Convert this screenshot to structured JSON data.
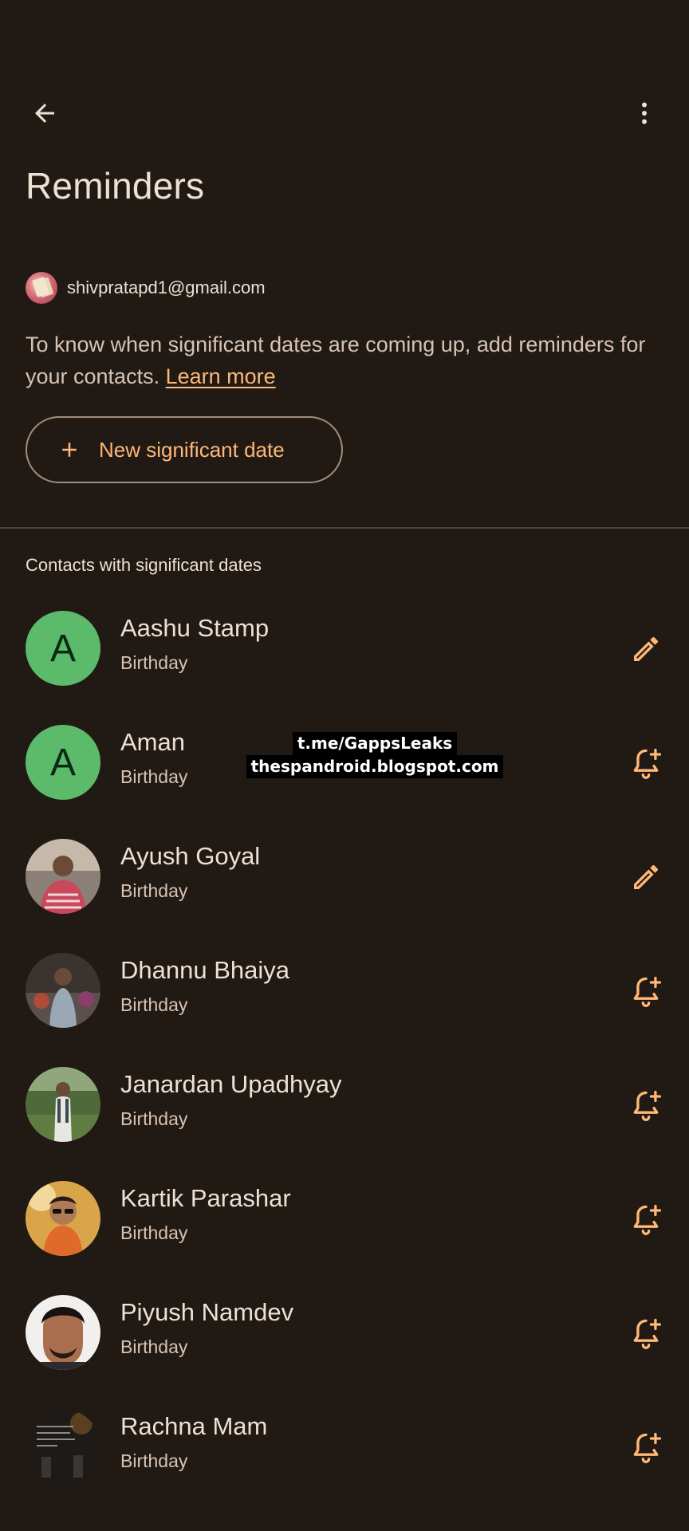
{
  "header": {
    "title": "Reminders",
    "back_icon": "arrow-back-icon",
    "more_icon": "more-vert-icon"
  },
  "account": {
    "email": "shivpratapd1@gmail.com"
  },
  "info": {
    "text": "To know when significant dates are coming up, add reminders for your contacts.",
    "link_label": "Learn more"
  },
  "new_date_button": {
    "label": "New significant date",
    "icon": "plus-icon"
  },
  "section": {
    "title": "Contacts with significant dates"
  },
  "contacts": [
    {
      "name": "Aashu Stamp",
      "subtitle": "Birthday",
      "avatar_type": "letter",
      "initial": "A",
      "action_icon": "edit-icon"
    },
    {
      "name": "Aman",
      "subtitle": "Birthday",
      "avatar_type": "letter",
      "initial": "A",
      "action_icon": "add-alert-icon"
    },
    {
      "name": "Ayush Goyal",
      "subtitle": "Birthday",
      "avatar_type": "photo",
      "action_icon": "edit-icon"
    },
    {
      "name": "Dhannu Bhaiya",
      "subtitle": "Birthday",
      "avatar_type": "photo",
      "action_icon": "add-alert-icon"
    },
    {
      "name": "Janardan Upadhyay",
      "subtitle": "Birthday",
      "avatar_type": "photo",
      "action_icon": "add-alert-icon"
    },
    {
      "name": "Kartik Parashar",
      "subtitle": "Birthday",
      "avatar_type": "photo",
      "action_icon": "add-alert-icon"
    },
    {
      "name": "Piyush Namdev",
      "subtitle": "Birthday",
      "avatar_type": "photo",
      "action_icon": "add-alert-icon"
    },
    {
      "name": "Rachna Mam",
      "subtitle": "Birthday",
      "avatar_type": "photo",
      "action_icon": "add-alert-icon"
    }
  ],
  "watermark": {
    "line1": "t.me/GappsLeaks",
    "line2": "thespandroid.blogspot.com"
  },
  "colors": {
    "background": "#211a14",
    "accent": "#ffb877",
    "letter_avatar": "#5cba6b",
    "text_primary": "#ede0d4",
    "text_secondary": "#d8c3b3"
  }
}
